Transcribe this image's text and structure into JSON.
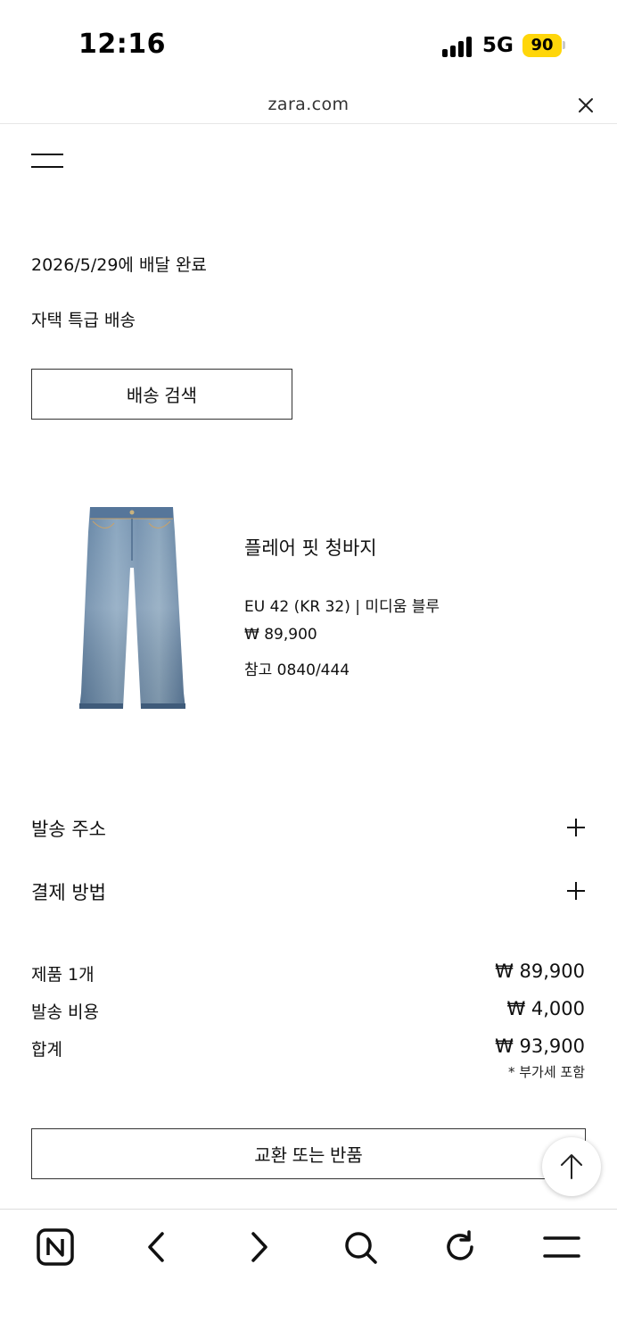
{
  "status_bar": {
    "time": "12:16",
    "network": "5G",
    "battery": "90",
    "battery_color": "#ffd60a"
  },
  "browser": {
    "url": "zara.com",
    "close_icon": "close-icon"
  },
  "order": {
    "delivery_status": "2026/5/29에 배달 완료",
    "delivery_method": "자택 특급 배송",
    "track_button": "배송 검색"
  },
  "product": {
    "image_icon": "jeans-image",
    "name": "플레어 핏 청바지",
    "size_color": "EU 42 (KR 32) | 미디움 블루",
    "price": "₩ 89,900",
    "reference": "참고 0840/444"
  },
  "sections": [
    {
      "label": "발송 주소",
      "icon": "plus-icon"
    },
    {
      "label": "결제 방법",
      "icon": "plus-icon"
    }
  ],
  "summary": {
    "items_label": "제품 1개",
    "items_value": "₩ 89,900",
    "shipping_label": "발송 비용",
    "shipping_value": "₩ 4,000",
    "total_label": "합계",
    "total_value": "₩ 93,900",
    "vat_note": "* 부가세 포함"
  },
  "exchange_button": "교환 또는 반품",
  "toolbar": {
    "icons": [
      "naver-home-icon",
      "back-icon",
      "forward-icon",
      "search-icon",
      "reload-icon",
      "menu-icon"
    ]
  }
}
